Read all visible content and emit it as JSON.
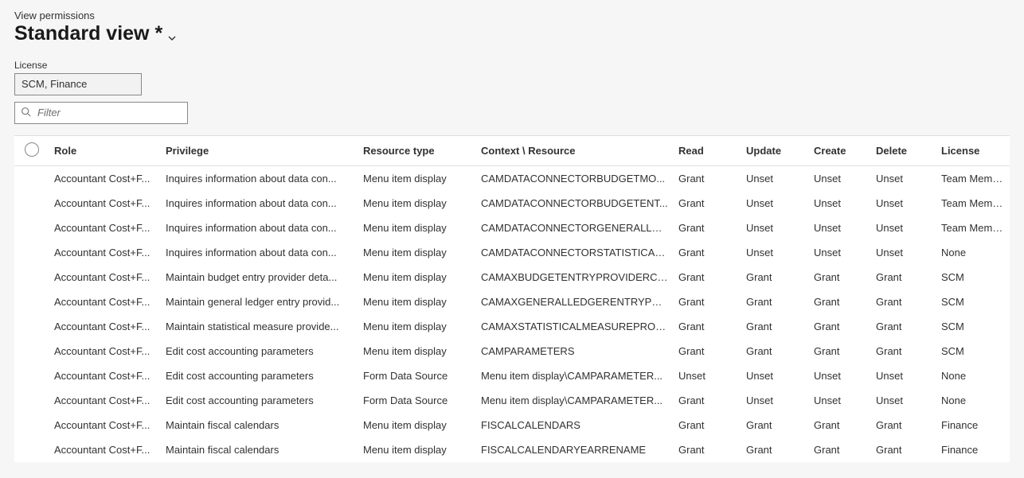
{
  "header": {
    "subtitle": "View permissions",
    "view_title": "Standard view *"
  },
  "license_field": {
    "label": "License",
    "value": "SCM, Finance"
  },
  "filter": {
    "placeholder": "Filter"
  },
  "table": {
    "headers": {
      "role": "Role",
      "privilege": "Privilege",
      "resource_type": "Resource type",
      "context_resource": "Context \\ Resource",
      "read": "Read",
      "update": "Update",
      "create": "Create",
      "delete": "Delete",
      "license": "License"
    },
    "rows": [
      {
        "role": "Accountant Cost+F...",
        "privilege": "Inquires information about data con...",
        "resource_type": "Menu item display",
        "context_resource": "CAMDATACONNECTORBUDGETMO...",
        "read": "Grant",
        "update": "Unset",
        "create": "Unset",
        "del": "Unset",
        "license": "Team Members"
      },
      {
        "role": "Accountant Cost+F...",
        "privilege": "Inquires information about data con...",
        "resource_type": "Menu item display",
        "context_resource": "CAMDATACONNECTORBUDGETENT...",
        "read": "Grant",
        "update": "Unset",
        "create": "Unset",
        "del": "Unset",
        "license": "Team Members"
      },
      {
        "role": "Accountant Cost+F...",
        "privilege": "Inquires information about data con...",
        "resource_type": "Menu item display",
        "context_resource": "CAMDATACONNECTORGENERALLED...",
        "read": "Grant",
        "update": "Unset",
        "create": "Unset",
        "del": "Unset",
        "license": "Team Members"
      },
      {
        "role": "Accountant Cost+F...",
        "privilege": "Inquires information about data con...",
        "resource_type": "Menu item display",
        "context_resource": "CAMDATACONNECTORSTATISTICAL...",
        "read": "Grant",
        "update": "Unset",
        "create": "Unset",
        "del": "Unset",
        "license": "None"
      },
      {
        "role": "Accountant Cost+F...",
        "privilege": "Maintain budget entry provider deta...",
        "resource_type": "Menu item display",
        "context_resource": "CAMAXBUDGETENTRYPROVIDERCO...",
        "read": "Grant",
        "update": "Grant",
        "create": "Grant",
        "del": "Grant",
        "license": "SCM"
      },
      {
        "role": "Accountant Cost+F...",
        "privilege": "Maintain general ledger entry provid...",
        "resource_type": "Menu item display",
        "context_resource": "CAMAXGENERALLEDGERENTRYPRO...",
        "read": "Grant",
        "update": "Grant",
        "create": "Grant",
        "del": "Grant",
        "license": "SCM"
      },
      {
        "role": "Accountant Cost+F...",
        "privilege": "Maintain statistical measure provide...",
        "resource_type": "Menu item display",
        "context_resource": "CAMAXSTATISTICALMEASUREPROVI...",
        "read": "Grant",
        "update": "Grant",
        "create": "Grant",
        "del": "Grant",
        "license": "SCM"
      },
      {
        "role": "Accountant Cost+F...",
        "privilege": "Edit cost accounting parameters",
        "resource_type": "Menu item display",
        "context_resource": "CAMPARAMETERS",
        "read": "Grant",
        "update": "Grant",
        "create": "Grant",
        "del": "Grant",
        "license": "SCM"
      },
      {
        "role": "Accountant Cost+F...",
        "privilege": "Edit cost accounting parameters",
        "resource_type": "Form Data Source",
        "context_resource": "Menu item display\\CAMPARAMETER...",
        "read": "Unset",
        "update": "Unset",
        "create": "Unset",
        "del": "Unset",
        "license": "None"
      },
      {
        "role": "Accountant Cost+F...",
        "privilege": "Edit cost accounting parameters",
        "resource_type": "Form Data Source",
        "context_resource": "Menu item display\\CAMPARAMETER...",
        "read": "Grant",
        "update": "Unset",
        "create": "Unset",
        "del": "Unset",
        "license": "None"
      },
      {
        "role": "Accountant Cost+F...",
        "privilege": "Maintain fiscal calendars",
        "resource_type": "Menu item display",
        "context_resource": "FISCALCALENDARS",
        "read": "Grant",
        "update": "Grant",
        "create": "Grant",
        "del": "Grant",
        "license": "Finance"
      },
      {
        "role": "Accountant Cost+F...",
        "privilege": "Maintain fiscal calendars",
        "resource_type": "Menu item display",
        "context_resource": "FISCALCALENDARYEARRENAME",
        "read": "Grant",
        "update": "Grant",
        "create": "Grant",
        "del": "Grant",
        "license": "Finance"
      }
    ]
  }
}
